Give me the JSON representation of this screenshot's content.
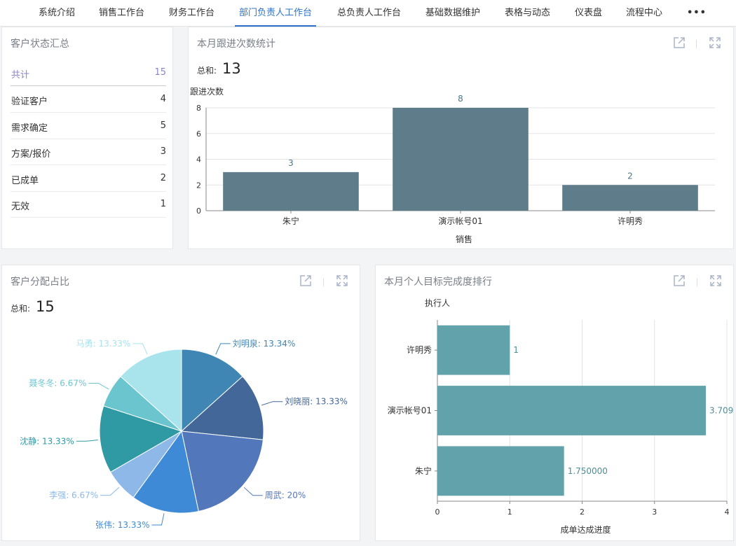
{
  "nav": {
    "items": [
      {
        "label": "系统介绍",
        "active": false
      },
      {
        "label": "销售工作台",
        "active": false
      },
      {
        "label": "财务工作台",
        "active": false
      },
      {
        "label": "部门负责人工作台",
        "active": true
      },
      {
        "label": "总负责人工作台",
        "active": false
      },
      {
        "label": "基础数据维护",
        "active": false
      },
      {
        "label": "表格与动态",
        "active": false
      },
      {
        "label": "仪表盘",
        "active": false
      },
      {
        "label": "流程中心",
        "active": false
      }
    ],
    "more_label": "•••"
  },
  "status_panel": {
    "title": "客户状态汇总",
    "total": {
      "label": "共计",
      "value": "15"
    },
    "rows": [
      {
        "label": "验证客户",
        "value": "4"
      },
      {
        "label": "需求确定",
        "value": "5"
      },
      {
        "label": "方案/报价",
        "value": "3"
      },
      {
        "label": "已成单",
        "value": "2"
      },
      {
        "label": "无效",
        "value": "1"
      }
    ]
  },
  "followup_panel": {
    "title": "本月跟进次数统计",
    "sum_label": "总和:",
    "sum_value": "13",
    "external_icon": "external-link-icon",
    "fullscreen_icon": "fullscreen-icon"
  },
  "distribution_panel": {
    "title": "客户分配占比",
    "sum_label": "总和:",
    "sum_value": "15"
  },
  "ranking_panel": {
    "title": "本月个人目标完成度排行"
  },
  "chart_data": [
    {
      "type": "bar",
      "ylabel": "跟进次数",
      "xlabel": "销售",
      "categories": [
        "朱宁",
        "演示帐号01",
        "许明秀"
      ],
      "values": [
        3,
        8,
        2
      ],
      "data_labels": [
        "3",
        "8",
        "2"
      ],
      "ylim": [
        0,
        8
      ],
      "yticks": [
        0,
        2,
        4,
        6,
        8
      ],
      "color": "#5f7c8a",
      "grid": true
    },
    {
      "type": "pie",
      "labels": [
        "刘明泉",
        "刘晓丽",
        "周武",
        "张伟",
        "李强",
        "沈静",
        "聂冬冬",
        "马勇"
      ],
      "values": [
        13.34,
        13.33,
        20,
        13.33,
        6.67,
        13.33,
        6.67,
        13.33
      ],
      "display_labels": [
        "刘明泉: 13.34%",
        "刘晓丽: 13.33%",
        "周武: 20%",
        "张伟: 13.33%",
        "李强: 6.67%",
        "沈静: 13.33%",
        "聂冬冬: 6.67%",
        "马勇: 13.33%"
      ],
      "colors": [
        "#3f86b5",
        "#436799",
        "#5277bb",
        "#3f8ad6",
        "#8db8e8",
        "#2f9aa4",
        "#6bc5cf",
        "#a9e3ec"
      ]
    },
    {
      "type": "bar",
      "orientation": "horizontal",
      "ylabel": "执行人",
      "xlabel": "成单达成进度",
      "categories": [
        "许明秀",
        "演示帐号01",
        "朱宁"
      ],
      "values": [
        1,
        3.709,
        1.75
      ],
      "data_labels": [
        "1",
        "3.709",
        "1.750000"
      ],
      "xlim": [
        0,
        4
      ],
      "xticks": [
        0,
        1,
        2,
        3,
        4
      ],
      "color": "#62a2aa",
      "grid": true
    }
  ]
}
